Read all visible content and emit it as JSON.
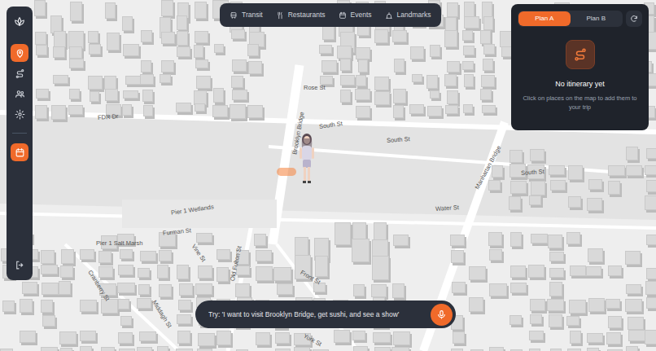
{
  "sidebar": {
    "items": [
      {
        "selected": true
      },
      {
        "selected": false
      },
      {
        "selected": false
      },
      {
        "selected": false
      }
    ],
    "actions": [
      {
        "selected": true
      }
    ]
  },
  "categories": [
    {
      "label": "Transit"
    },
    {
      "label": "Restaurants"
    },
    {
      "label": "Events"
    },
    {
      "label": "Landmarks"
    }
  ],
  "plans": {
    "tabs": [
      {
        "label": "Plan A",
        "selected": true
      },
      {
        "label": "Plan B",
        "selected": false
      }
    ],
    "empty_title": "No itinerary yet",
    "empty_hint": "Click on places on the map to add them to your trip"
  },
  "chat": {
    "placeholder": "Try: 'I want to visit Brooklyn Bridge, get sushi, and see a show'"
  },
  "map": {
    "labels": [
      {
        "text": "FDR Dr"
      },
      {
        "text": "Rose St"
      },
      {
        "text": "South St"
      },
      {
        "text": "South St"
      },
      {
        "text": "South St"
      },
      {
        "text": "Brooklyn Bridge"
      },
      {
        "text": "Manhattan Bridge"
      },
      {
        "text": "Pier 1 Salt Marsh"
      },
      {
        "text": "Pier 1 Wetlands"
      },
      {
        "text": "Furman St"
      },
      {
        "text": "Old Fulton St"
      },
      {
        "text": "Vine St"
      },
      {
        "text": "Cranberry St"
      },
      {
        "text": "Middagh St"
      },
      {
        "text": "Front St"
      },
      {
        "text": "York St"
      },
      {
        "text": "Water St"
      }
    ]
  }
}
